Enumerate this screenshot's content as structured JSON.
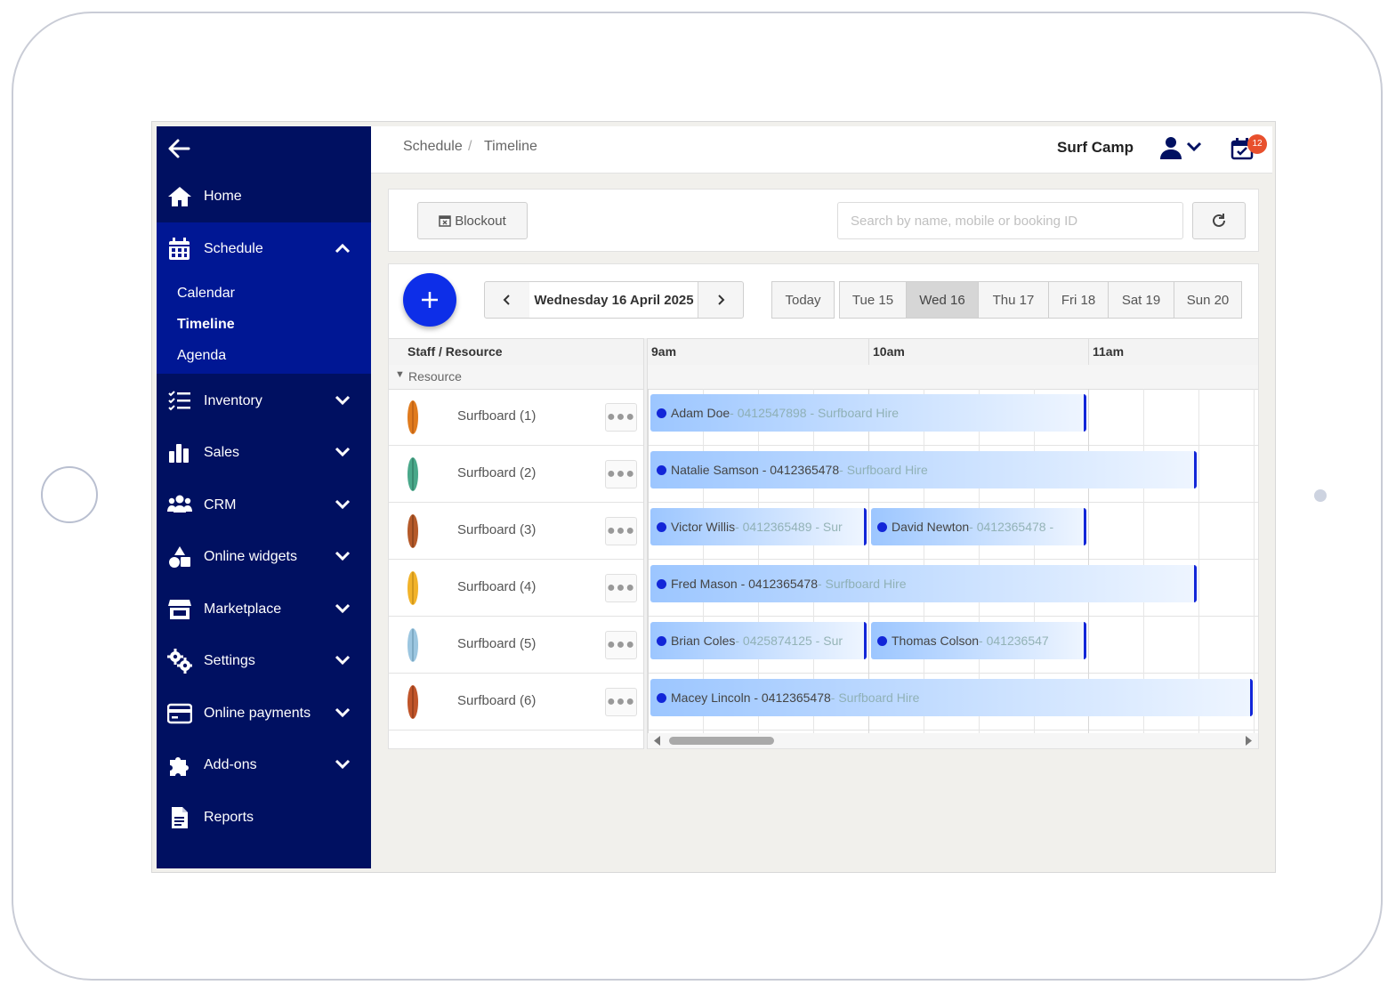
{
  "sidebar": {
    "items": [
      {
        "label": "Home",
        "icon": "home-icon"
      },
      {
        "label": "Schedule",
        "icon": "calendar-grid-icon",
        "expanded": true
      },
      {
        "label": "Inventory",
        "icon": "checklist-icon"
      },
      {
        "label": "Sales",
        "icon": "bar-chart-icon"
      },
      {
        "label": "CRM",
        "icon": "users-icon"
      },
      {
        "label": "Online widgets",
        "icon": "shapes-icon"
      },
      {
        "label": "Marketplace",
        "icon": "store-icon"
      },
      {
        "label": "Settings",
        "icon": "gears-icon"
      },
      {
        "label": "Online payments",
        "icon": "credit-card-icon"
      },
      {
        "label": "Add-ons",
        "icon": "puzzle-icon"
      },
      {
        "label": "Reports",
        "icon": "document-icon"
      }
    ],
    "schedule_sub": [
      "Calendar",
      "Timeline",
      "Agenda"
    ],
    "active_sub": "Timeline"
  },
  "header": {
    "breadcrumb": [
      "Schedule",
      "Timeline"
    ],
    "separator": "/",
    "business_name": "Surf Camp",
    "notification_count": "12"
  },
  "toolbar": {
    "blockout_label": "Blockout",
    "search_placeholder": "Search by name, mobile or booking ID"
  },
  "timeline": {
    "current_date": "Wednesday 16 April 2025",
    "today_label": "Today",
    "days": [
      "Tue 15",
      "Wed 16",
      "Thu 17",
      "Fri 18",
      "Sat 19",
      "Sun 20"
    ],
    "selected_day": "Wed 16",
    "column_header": "Staff / Resource",
    "hours": [
      "9am",
      "10am",
      "11am"
    ],
    "group_label": "Resource",
    "resources": [
      {
        "name": "Surfboard (1)",
        "color": "#e07b1e"
      },
      {
        "name": "Surfboard (2)",
        "color": "#4aa88a"
      },
      {
        "name": "Surfboard (3)",
        "color": "#b55a2a"
      },
      {
        "name": "Surfboard (4)",
        "color": "#f2b32a"
      },
      {
        "name": "Surfboard (5)",
        "color": "#9cc6e0"
      },
      {
        "name": "Surfboard (6)",
        "color": "#c0552a"
      }
    ],
    "bookings": [
      {
        "row": 0,
        "name": "Adam Doe",
        "detail": " - 0412547898 - Surfboard Hire"
      },
      {
        "row": 1,
        "name": "Natalie Samson - 0412365478",
        "detail": " - Surfboard Hire"
      },
      {
        "row": 2,
        "name": "Victor Willis",
        "detail": " - 0412365489 - Sur"
      },
      {
        "row": 2,
        "name": "David Newton",
        "detail": " - 0412365478 -"
      },
      {
        "row": 3,
        "name": "Fred Mason - 0412365478",
        "detail": " - Surfboard Hire"
      },
      {
        "row": 4,
        "name": "Brian Coles",
        "detail": " - 0425874125 - Sur"
      },
      {
        "row": 4,
        "name": "Thomas Colson",
        "detail": " - 041236547"
      },
      {
        "row": 5,
        "name": "Macey Lincoln - 0412365478",
        "detail": " - Surfboard Hire"
      }
    ]
  },
  "colors": {
    "sidebar_bg": "#001061",
    "sidebar_active": "#001794",
    "accent": "#0d2ee8",
    "badge": "#e8502d"
  }
}
